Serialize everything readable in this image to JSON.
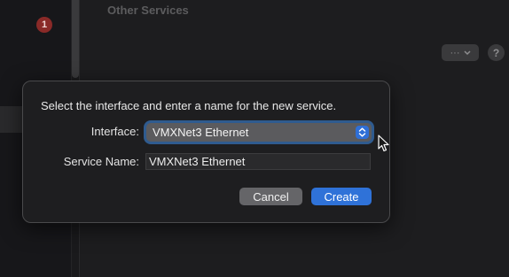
{
  "sidebar": {
    "badge_count": "1"
  },
  "main": {
    "section_title": "Other Services",
    "more_button_label": "···",
    "help_button_label": "?"
  },
  "sheet": {
    "prompt": "Select the interface and enter a name for the new service.",
    "interface_label": "Interface:",
    "interface_value": "VMXNet3 Ethernet",
    "service_name_label": "Service Name:",
    "service_name_value": "VMXNet3 Ethernet",
    "cancel_label": "Cancel",
    "create_label": "Create"
  },
  "colors": {
    "accent": "#2f72d8",
    "badge": "#8a2a28"
  }
}
